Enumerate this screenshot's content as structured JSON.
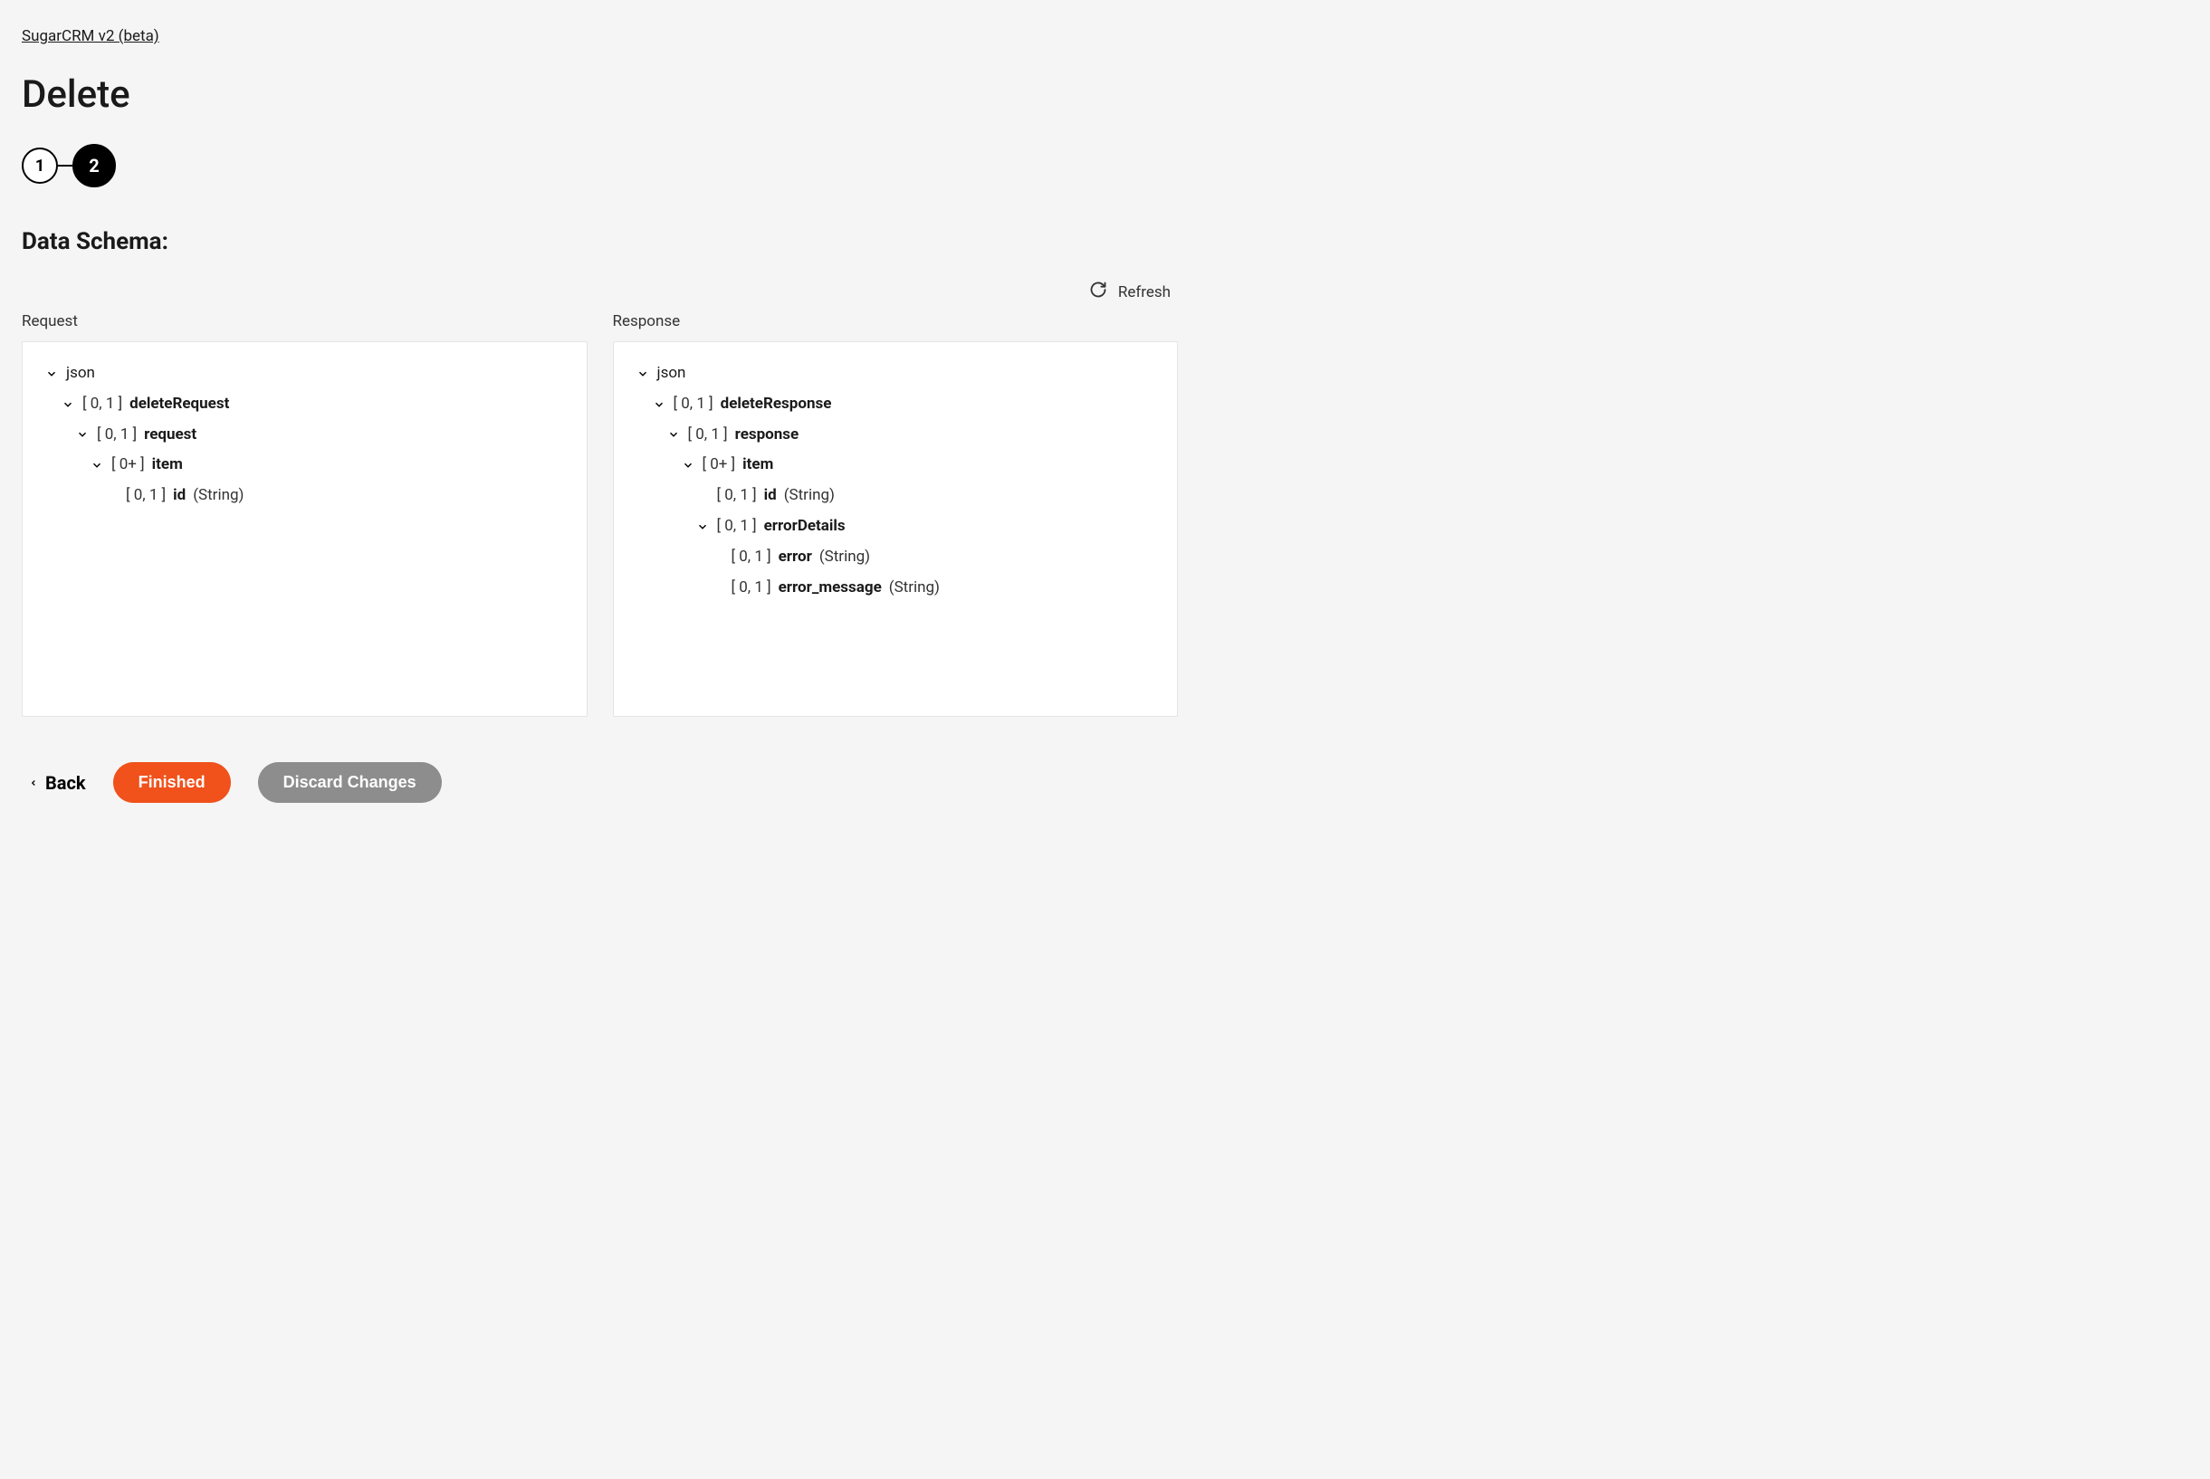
{
  "breadcrumb": "SugarCRM v2 (beta)",
  "title": "Delete",
  "stepper": {
    "step1": "1",
    "step2": "2"
  },
  "section_title": "Data Schema:",
  "refresh_label": "Refresh",
  "panels": {
    "request_label": "Request",
    "response_label": "Response"
  },
  "schema": {
    "json_label": "json",
    "card_01": "[ 0, 1 ]",
    "card_0p": "[ 0+ ]",
    "type_string": "(String)",
    "request": {
      "deleteRequest": "deleteRequest",
      "request": "request",
      "item": "item",
      "id": "id"
    },
    "response": {
      "deleteResponse": "deleteResponse",
      "response": "response",
      "item": "item",
      "id": "id",
      "errorDetails": "errorDetails",
      "error": "error",
      "error_message": "error_message"
    }
  },
  "footer": {
    "back": "Back",
    "finished": "Finished",
    "discard": "Discard Changes"
  }
}
